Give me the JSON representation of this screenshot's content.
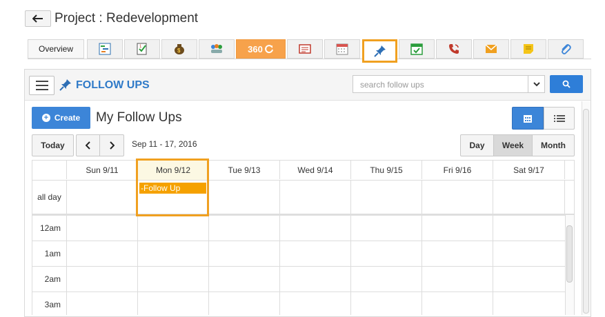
{
  "header": {
    "back_icon": "arrow-left-icon",
    "project_title": "Project : Redevelopment"
  },
  "tabs": [
    {
      "label": "Overview",
      "icon": ""
    },
    {
      "label": "",
      "icon": "gantt-icon"
    },
    {
      "label": "",
      "icon": "task-checklist-icon"
    },
    {
      "label": "",
      "icon": "money-bag-icon"
    },
    {
      "label": "",
      "icon": "team-icon"
    },
    {
      "label": "360",
      "icon": "refresh-icon"
    },
    {
      "label": "",
      "icon": "document-icon"
    },
    {
      "label": "",
      "icon": "calendar-icon"
    },
    {
      "label": "",
      "icon": "pin-icon",
      "active": true
    },
    {
      "label": "",
      "icon": "calendar-check-icon"
    },
    {
      "label": "",
      "icon": "phone-icon"
    },
    {
      "label": "",
      "icon": "mail-icon"
    },
    {
      "label": "",
      "icon": "note-icon"
    },
    {
      "label": "",
      "icon": "paperclip-icon"
    }
  ],
  "panel": {
    "title": "FOLLOW UPS",
    "search_placeholder": "search follow ups",
    "create_label": "Create",
    "list_title": "My Follow Ups"
  },
  "calendar": {
    "today_label": "Today",
    "date_range": "Sep 11 - 17, 2016",
    "views": {
      "day": "Day",
      "week": "Week",
      "month": "Month"
    },
    "selected_view": "Week",
    "days": [
      "Sun 9/11",
      "Mon 9/12",
      "Tue 9/13",
      "Wed 9/14",
      "Thu 9/15",
      "Fri 9/16",
      "Sat 9/17"
    ],
    "allday_label": "all day",
    "times": [
      "12am",
      "1am",
      "2am",
      "3am"
    ],
    "event": {
      "title": "-Follow Up",
      "day": "Mon 9/12"
    }
  },
  "colors": {
    "accent_blue": "#2e7ed8",
    "highlight_orange": "#f0a020",
    "event_orange": "#f5a100",
    "title_blue": "#2f7ac8"
  }
}
